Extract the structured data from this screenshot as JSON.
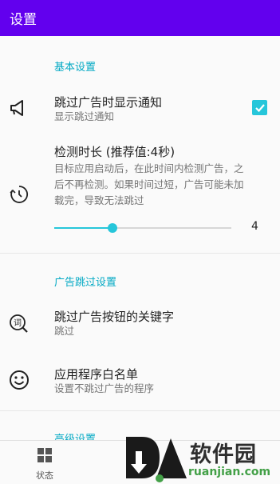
{
  "appbar": {
    "title": "设置"
  },
  "sections": {
    "basic": "基本设置",
    "ad_skip": "广告跳过设置",
    "advanced": "高级设置"
  },
  "prefs": {
    "show_notification": {
      "title": "跳过广告时显示通知",
      "summary": "显示跳过通知",
      "checked": true,
      "icon": "megaphone-icon"
    },
    "detect_duration": {
      "title": "检测时长 (推荐值:4秒)",
      "summary_lines": [
        "目标应用启动后，在此时间内检测广告，之",
        "后不再检测。如果时间过短，广告可能未加",
        "载完，导致无法跳过"
      ],
      "value": "4",
      "slider_fraction": 0.33,
      "icon": "timer-icon"
    },
    "keywords": {
      "title": "跳过广告按钮的关键字",
      "summary": "跳过",
      "icon": "keyword-search-icon",
      "icon_glyph": "词"
    },
    "whitelist": {
      "title": "应用程序白名单",
      "summary": "设置不跳过广告的程序",
      "icon": "smiley-icon"
    }
  },
  "bottom_nav": {
    "status_label": "状态",
    "status_icon": "grid-icon"
  },
  "watermark": {
    "text": "软件园",
    "url": "ruanjian.com"
  },
  "colors": {
    "appbar": "#6200ee",
    "accent": "#26c6da",
    "section_header": "#03a9c4"
  }
}
